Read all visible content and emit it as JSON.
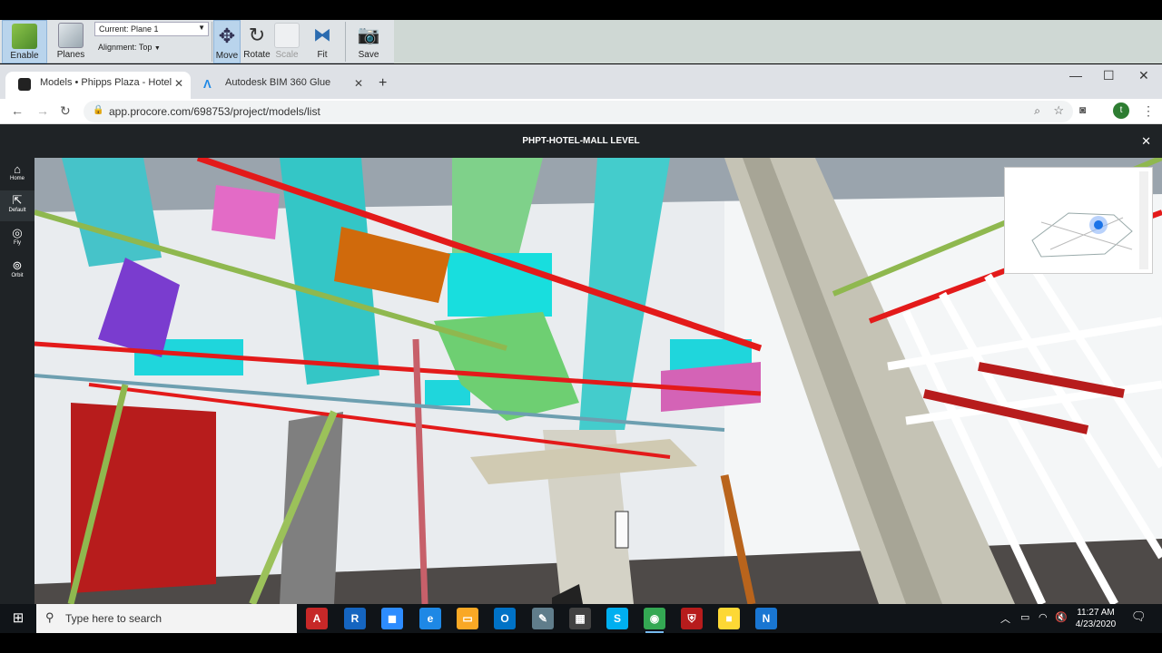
{
  "navis_ribbon": {
    "enable_label": "Enable",
    "planes_label": "Planes",
    "current_plane": "Current: Plane 1",
    "alignment": "Alignment: Top",
    "move_label": "Move",
    "rotate_label": "Rotate",
    "scale_label": "Scale",
    "fit_label": "Fit",
    "save_label": "Save"
  },
  "browser": {
    "tabs": [
      {
        "title": "Models • Phipps Plaza - Hotel",
        "icon": "procore-icon"
      },
      {
        "title": "Autodesk BIM 360 Glue",
        "icon": "bim360-icon"
      }
    ],
    "url": "app.procore.com/698753/project/models/list",
    "avatar_initial": "t"
  },
  "viewer": {
    "title": "PHPT-HOTEL-MALL LEVEL",
    "tools": [
      {
        "label": "Home",
        "icon": "home-icon"
      },
      {
        "label": "Default",
        "icon": "cursor-icon"
      },
      {
        "label": "Fly",
        "icon": "fly-icon"
      },
      {
        "label": "Orbit",
        "icon": "orbit-icon"
      }
    ]
  },
  "taskbar": {
    "search_placeholder": "Type here to search",
    "apps": [
      {
        "name": "autocad",
        "glyph": "A",
        "color": "#c62828"
      },
      {
        "name": "revit",
        "glyph": "R",
        "color": "#1565c0"
      },
      {
        "name": "zoom",
        "glyph": "◼",
        "color": "#2d8cff"
      },
      {
        "name": "edge",
        "glyph": "e",
        "color": "#1e88e5"
      },
      {
        "name": "file-explorer",
        "glyph": "▭",
        "color": "#f9a825"
      },
      {
        "name": "outlook",
        "glyph": "O",
        "color": "#0072c6"
      },
      {
        "name": "paint",
        "glyph": "✎",
        "color": "#607d8b"
      },
      {
        "name": "calculator",
        "glyph": "▦",
        "color": "#424242"
      },
      {
        "name": "skype",
        "glyph": "S",
        "color": "#00aff0"
      },
      {
        "name": "chrome",
        "glyph": "◉",
        "color": "#34a853"
      },
      {
        "name": "security",
        "glyph": "⛨",
        "color": "#b71c1c"
      },
      {
        "name": "sticky-notes",
        "glyph": "■",
        "color": "#fdd835"
      },
      {
        "name": "navisworks",
        "glyph": "N",
        "color": "#1976d2"
      }
    ],
    "time": "11:27 AM",
    "date": "4/23/2020"
  }
}
